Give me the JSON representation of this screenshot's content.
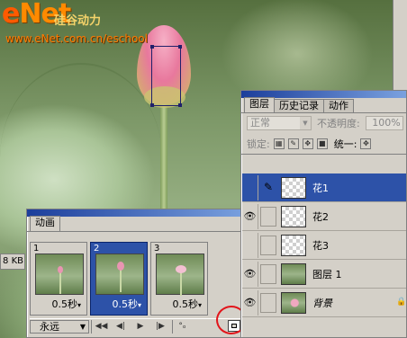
{
  "watermark": {
    "logo_e": "e",
    "logo_rest": "Net",
    "logo_sub": "硅谷动力",
    "url": "www.eNet.com.cn/eschool"
  },
  "document": {
    "status_text": "8 KB"
  },
  "animation_panel": {
    "tab_label": "动画",
    "frames": [
      {
        "number": "1",
        "delay": "0.5秒",
        "flower": "bud"
      },
      {
        "number": "2",
        "delay": "0.5秒",
        "flower": "bud-tall"
      },
      {
        "number": "3",
        "delay": "0.5秒",
        "flower": "open"
      }
    ],
    "selected_frame": "2",
    "loop_option": "永远",
    "controls": [
      "first-frame-icon",
      "previous-frame-icon",
      "play-icon",
      "next-frame-icon",
      "tween-icon",
      "new-frame-icon"
    ],
    "highlight_color": "#e2141a"
  },
  "layers_panel": {
    "tabs": [
      "图层",
      "历史记录",
      "动作"
    ],
    "active_tab": "图层",
    "blend_mode": "正常",
    "opacity_label": "不透明度:",
    "opacity_value": "100%",
    "lock_label": "锁定:",
    "unify_label": "统一:",
    "layers": [
      {
        "name": "花1",
        "visible": false,
        "selected": true,
        "thumb": "transparent"
      },
      {
        "name": "花2",
        "visible": true,
        "selected": false,
        "thumb": "transparent"
      },
      {
        "name": "花3",
        "visible": false,
        "selected": false,
        "thumb": "transparent"
      },
      {
        "name": "图层 1",
        "visible": true,
        "selected": false,
        "thumb": "photo"
      },
      {
        "name": "背景",
        "visible": true,
        "selected": false,
        "thumb": "photo",
        "italic": true,
        "locked": true
      }
    ],
    "selection_color": "#2d52a8"
  }
}
